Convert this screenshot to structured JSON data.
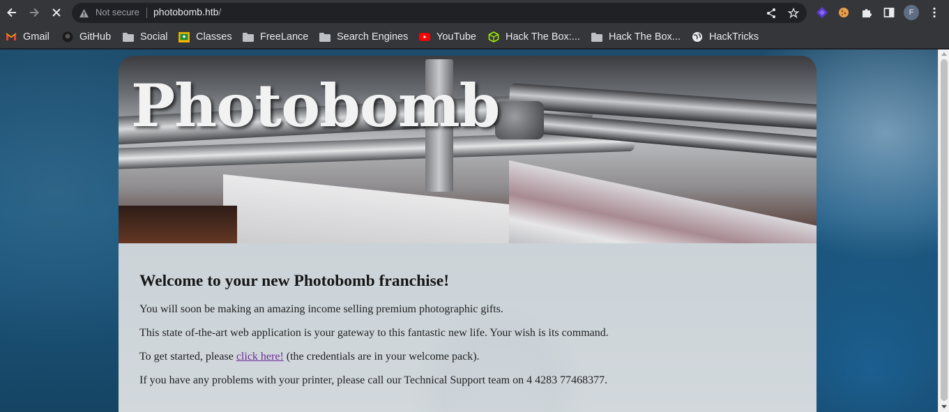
{
  "browser": {
    "omnibox": {
      "security_label": "Not secure",
      "url_host": "photobomb.htb",
      "url_path": "/"
    },
    "profile_initial": "F",
    "bookmarks": [
      {
        "label": "Gmail",
        "icon": "gmail-icon"
      },
      {
        "label": "GitHub",
        "icon": "github-icon"
      },
      {
        "label": "Social",
        "icon": "folder-icon"
      },
      {
        "label": "Classes",
        "icon": "classroom-icon"
      },
      {
        "label": "FreeLance",
        "icon": "folder-icon"
      },
      {
        "label": "Search Engines",
        "icon": "folder-icon"
      },
      {
        "label": "YouTube",
        "icon": "youtube-icon"
      },
      {
        "label": "Hack The Box:...",
        "icon": "hackthebox-icon"
      },
      {
        "label": "Hack The Box...",
        "icon": "folder-icon"
      },
      {
        "label": "HackTricks",
        "icon": "globe-icon"
      }
    ]
  },
  "page": {
    "site_title": "Photobomb",
    "heading": "Welcome to your new Photobomb franchise!",
    "para1": "You will soon be making an amazing income selling premium photographic gifts.",
    "para2": "This state of-the-art web application is your gateway to this fantastic new life. Your wish is its command.",
    "para3_before": "To get started, please ",
    "para3_link": "click here!",
    "para3_after": " (the credentials are in your welcome pack).",
    "para4": "If you have any problems with your printer, please call our Technical Support team on 4 4283 77468377."
  },
  "colors": {
    "chrome_toolbar": "#35363a",
    "omnibox": "#202124",
    "link_visited": "#6b2b99"
  }
}
